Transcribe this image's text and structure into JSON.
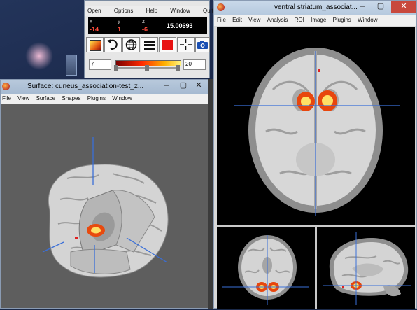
{
  "colors": {
    "crosshair": "#3a6fd8",
    "overlay_red": "#e02020",
    "activation_hot": "#ffe066"
  },
  "control_panel": {
    "menu": [
      "Open",
      "Options",
      "Help",
      "Window",
      "Quit"
    ],
    "coord_labels": [
      "x",
      "y",
      "z"
    ],
    "coord_values": [
      "-14",
      "1",
      "-6"
    ],
    "intensity": "15.00693",
    "tools": [
      "colorbar-icon",
      "undo-icon",
      "globe-icon",
      "layers-icon",
      "red-square-icon",
      "crosshair-icon",
      "camera-icon"
    ],
    "threshold_min": "7",
    "threshold_max": "20"
  },
  "surface_window": {
    "title": "Surface: cuneus_association-test_z...",
    "menu": [
      "File",
      "View",
      "Surface",
      "Shapes",
      "Plugins",
      "Window"
    ]
  },
  "slice_window": {
    "title": "ventral striatum_associat...",
    "menu": [
      "File",
      "Edit",
      "View",
      "Analysis",
      "ROI",
      "Image",
      "Plugins",
      "Window"
    ]
  }
}
